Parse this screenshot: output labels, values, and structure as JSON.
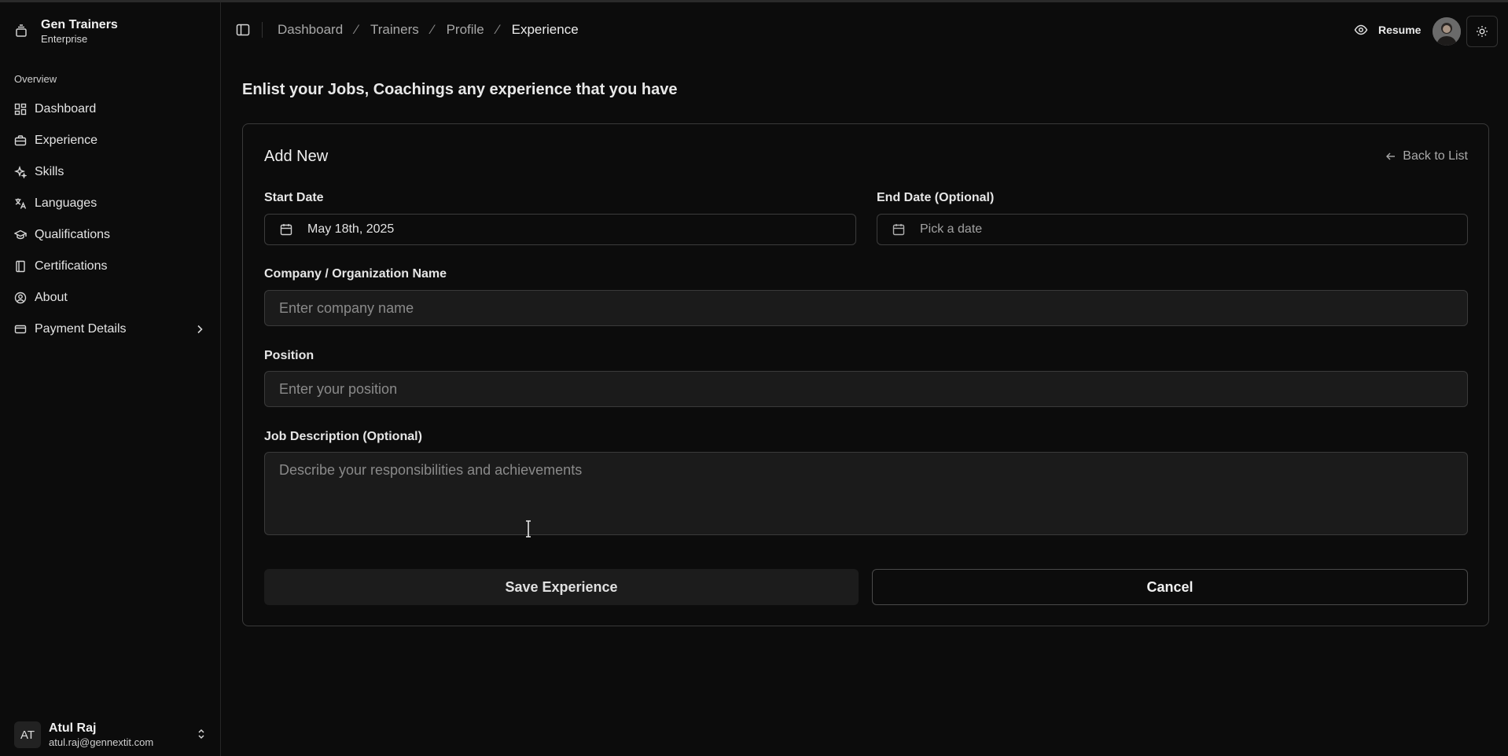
{
  "sidebar": {
    "brand_title": "Gen Trainers",
    "brand_subtitle": "Enterprise",
    "group_label": "Overview",
    "items": [
      {
        "label": "Dashboard",
        "icon": "grid-icon"
      },
      {
        "label": "Experience",
        "icon": "briefcase-icon"
      },
      {
        "label": "Skills",
        "icon": "sparkles-icon"
      },
      {
        "label": "Languages",
        "icon": "translate-icon"
      },
      {
        "label": "Qualifications",
        "icon": "graduation-cap-icon"
      },
      {
        "label": "Certifications",
        "icon": "book-icon"
      },
      {
        "label": "About",
        "icon": "user-circle-icon"
      },
      {
        "label": "Payment Details",
        "icon": "credit-card-icon"
      }
    ],
    "user": {
      "initials": "AT",
      "name": "Atul Raj",
      "email": "atul.raj@gennextit.com"
    }
  },
  "header": {
    "breadcrumbs": [
      "Dashboard",
      "Trainers",
      "Profile",
      "Experience"
    ],
    "separator": "⁄",
    "resume_label": "Resume"
  },
  "main": {
    "heading": "Enlist your Jobs, Coachings any experience that you have",
    "form": {
      "title": "Add New",
      "back_label": "Back to List",
      "start_date_label": "Start Date",
      "start_date_value": "May 18th, 2025",
      "end_date_label": "End Date (Optional)",
      "end_date_placeholder": "Pick a date",
      "company_label": "Company / Organization Name",
      "company_placeholder": "Enter company name",
      "position_label": "Position",
      "position_placeholder": "Enter your position",
      "description_label": "Job Description (Optional)",
      "description_placeholder": "Describe your responsibilities and achievements",
      "save_label": "Save Experience",
      "cancel_label": "Cancel"
    }
  },
  "colors": {
    "background": "#0c0c0c",
    "border": "#3a3a3a",
    "input_bg": "#1b1b1b",
    "text": "#e8e8e8",
    "muted": "#a8a8a8"
  }
}
